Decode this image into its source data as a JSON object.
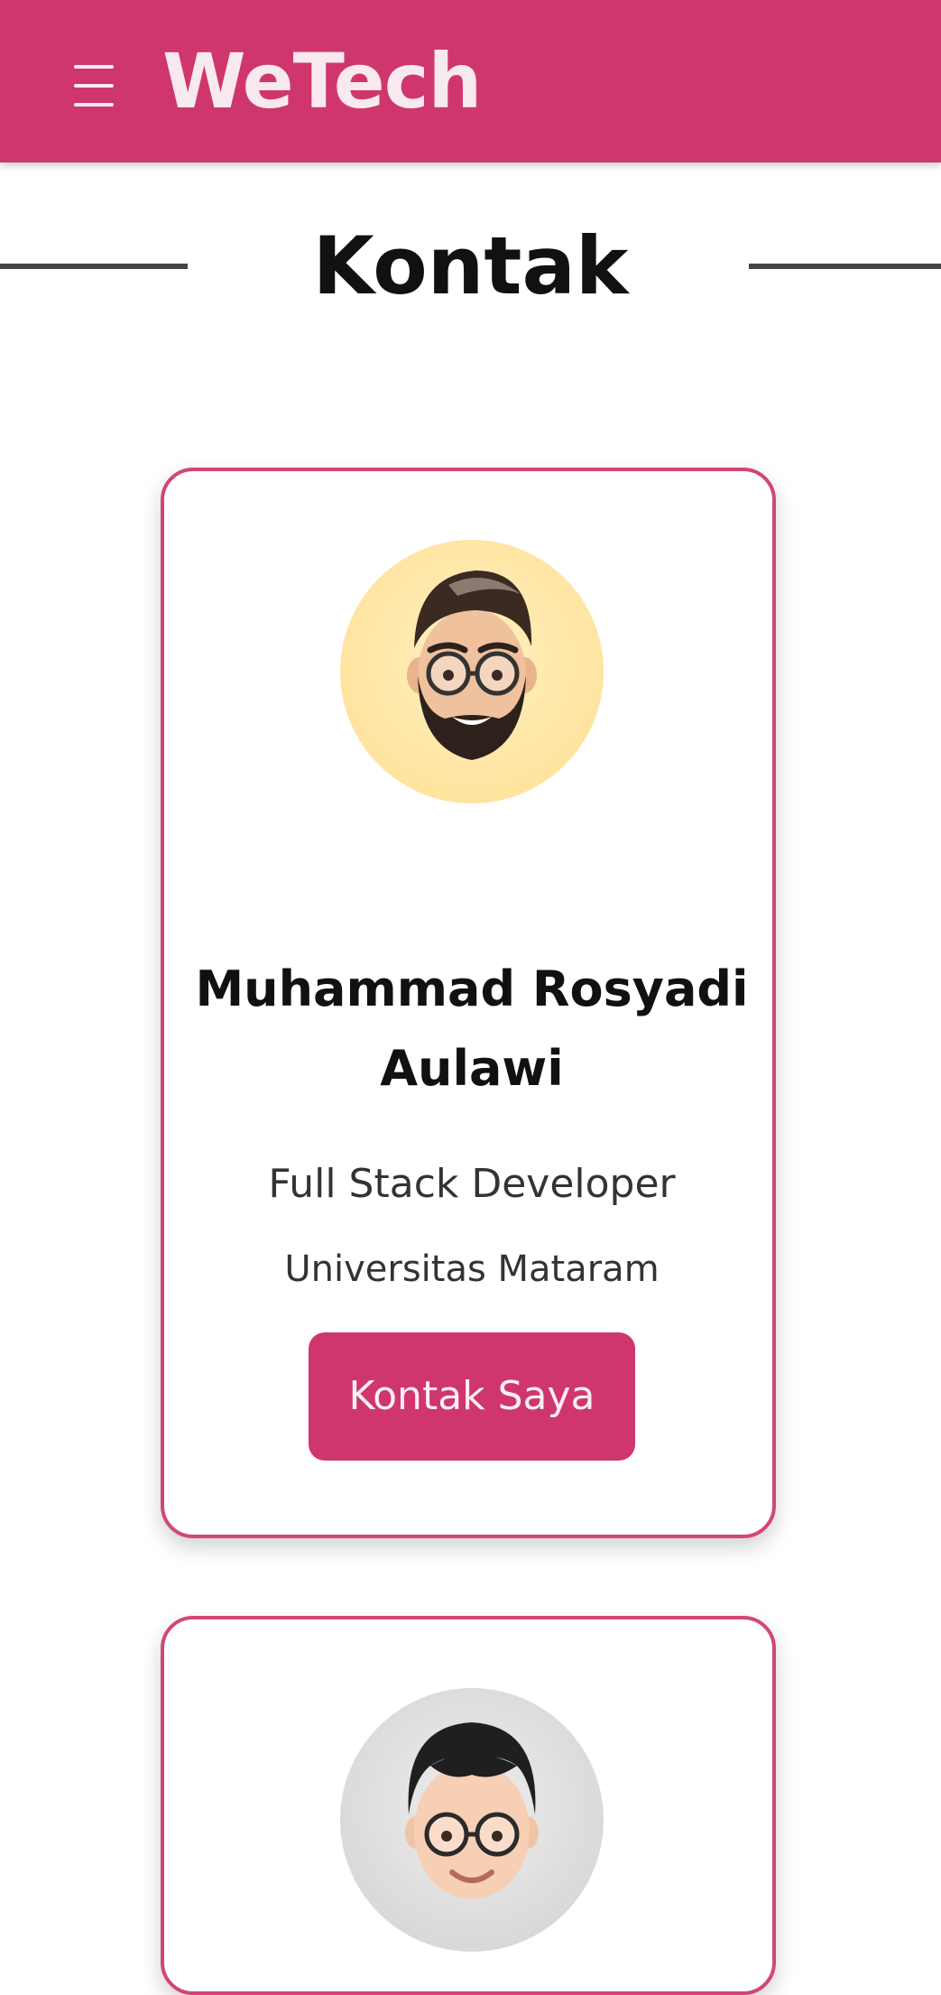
{
  "navbar": {
    "brand": "WeTech",
    "menu_icon": "hamburger-menu-icon",
    "background_color": "#cf366d"
  },
  "section": {
    "title": "Kontak"
  },
  "contacts": [
    {
      "name": "Muhammad Rosyadi Aulawi",
      "role": "Full Stack Developer",
      "university": "Universitas Mataram",
      "button_label": "Kontak Saya",
      "avatar_bg": "#ffe4a0"
    },
    {
      "avatar_bg": "#d8d8d8"
    }
  ],
  "colors": {
    "accent": "#cf366d",
    "card_border": "#d2467a"
  }
}
